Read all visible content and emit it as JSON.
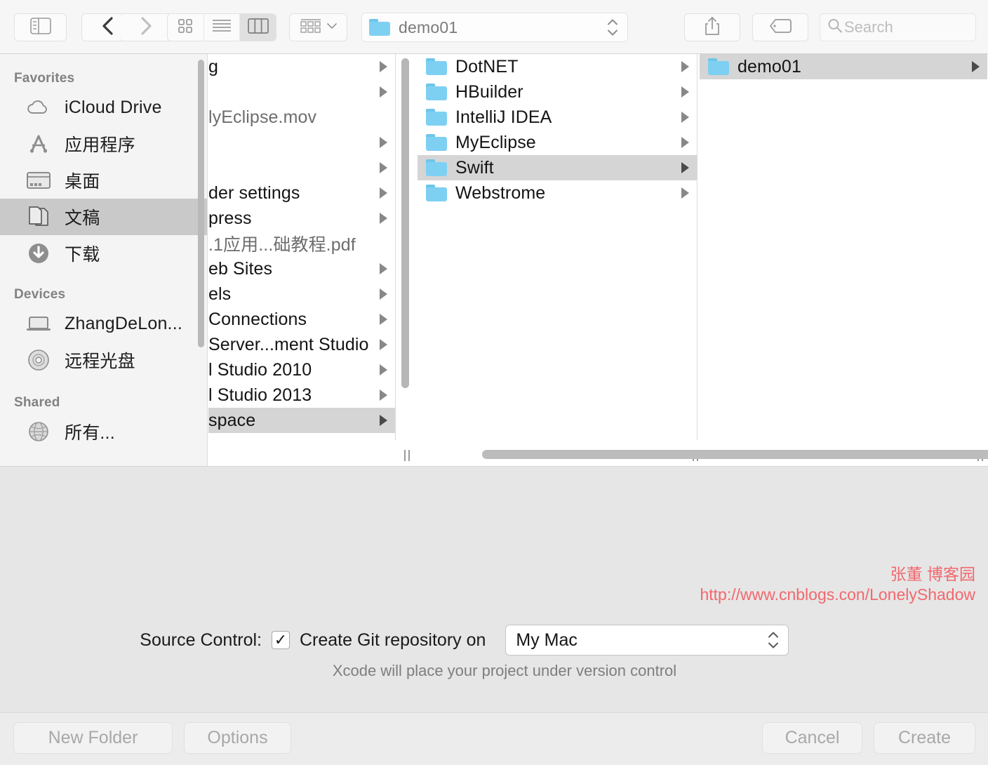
{
  "toolbar": {
    "sidebar_toggle_icon": "sidebar-toggle-icon",
    "back_icon": "chevron-left-icon",
    "forward_icon": "chevron-right-icon",
    "view_icon_grid": "grid-view-icon",
    "view_icon_list": "list-view-icon",
    "view_icon_column": "column-view-icon",
    "active_view": "column",
    "arrange_icon": "arrange-icon",
    "arrange_chevron": "chevron-down-icon",
    "path_value": "demo01",
    "path_folder_icon": "folder-icon",
    "stepper_icon": "stepper-up-down-icon",
    "share_icon": "share-icon",
    "tag_icon": "tag-icon",
    "search_icon": "search-icon",
    "search_placeholder": "Search",
    "search_value": ""
  },
  "sidebar": {
    "groups": [
      {
        "title": "Favorites",
        "items": [
          {
            "label": "iCloud Drive",
            "icon": "icloud-icon",
            "selected": false
          },
          {
            "label": "应用程序",
            "icon": "applications-icon",
            "selected": false
          },
          {
            "label": "桌面",
            "icon": "desktop-icon",
            "selected": false
          },
          {
            "label": "文稿",
            "icon": "documents-icon",
            "selected": true
          },
          {
            "label": "下载",
            "icon": "downloads-icon",
            "selected": false
          }
        ]
      },
      {
        "title": "Devices",
        "items": [
          {
            "label": "ZhangDeLon...",
            "icon": "laptop-icon",
            "selected": false
          },
          {
            "label": "远程光盘",
            "icon": "disc-icon",
            "selected": false
          }
        ]
      },
      {
        "title": "Shared",
        "items": [
          {
            "label": "所有...",
            "icon": "network-globe-icon",
            "selected": false
          }
        ]
      }
    ]
  },
  "columns": [
    {
      "name": "column-1",
      "scrolled_horizontally": true,
      "rows": [
        {
          "label": "g",
          "dim": false,
          "disclosure": true,
          "selected": false
        },
        {
          "label": "",
          "dim": false,
          "disclosure": true,
          "selected": false
        },
        {
          "label": "lyEclipse.mov",
          "dim": true,
          "disclosure": false,
          "selected": false
        },
        {
          "label": "",
          "dim": false,
          "disclosure": true,
          "selected": false
        },
        {
          "label": "",
          "dim": false,
          "disclosure": true,
          "selected": false
        },
        {
          "label": "der settings",
          "dim": false,
          "disclosure": true,
          "selected": false
        },
        {
          "label": "press",
          "dim": false,
          "disclosure": true,
          "selected": false
        },
        {
          "label": ".1应用...础教程.pdf",
          "dim": true,
          "disclosure": false,
          "selected": false
        },
        {
          "label": "eb Sites",
          "dim": false,
          "disclosure": true,
          "selected": false
        },
        {
          "label": "els",
          "dim": false,
          "disclosure": true,
          "selected": false
        },
        {
          "label": "Connections",
          "dim": false,
          "disclosure": true,
          "selected": false
        },
        {
          "label": "Server...ment Studio",
          "dim": false,
          "disclosure": true,
          "selected": false
        },
        {
          "label": "l Studio 2010",
          "dim": false,
          "disclosure": true,
          "selected": false
        },
        {
          "label": "l Studio 2013",
          "dim": false,
          "disclosure": true,
          "selected": false
        },
        {
          "label": "space",
          "dim": false,
          "disclosure": true,
          "selected": true
        }
      ]
    },
    {
      "name": "column-2",
      "scrolled_horizontally": false,
      "rows": [
        {
          "label": "DotNET",
          "icon": "folder-icon",
          "disclosure": true,
          "selected": false
        },
        {
          "label": "HBuilder",
          "icon": "folder-icon",
          "disclosure": true,
          "selected": false
        },
        {
          "label": "IntelliJ IDEA",
          "icon": "folder-icon",
          "disclosure": true,
          "selected": false
        },
        {
          "label": "MyEclipse",
          "icon": "folder-icon",
          "disclosure": true,
          "selected": false
        },
        {
          "label": "Swift",
          "icon": "folder-icon",
          "disclosure": true,
          "selected": true
        },
        {
          "label": "Webstrome",
          "icon": "folder-icon",
          "disclosure": true,
          "selected": false
        }
      ]
    },
    {
      "name": "column-3",
      "scrolled_horizontally": false,
      "rows": [
        {
          "label": "demo01",
          "icon": "folder-icon",
          "disclosure": true,
          "selected": true
        }
      ]
    }
  ],
  "watermark": {
    "line1": "张董 博客园",
    "line2": "http://www.cnblogs.con/LonelyShadow",
    "color": "#f2686e"
  },
  "source_control": {
    "label": "Source Control:",
    "checkbox_checked": true,
    "checkbox_glyph": "✓",
    "checkbox_label": "Create Git repository on",
    "select_value": "My Mac",
    "select_icon": "stepper-up-down-icon",
    "hint": "Xcode will place your project under version control"
  },
  "footer": {
    "new_folder_label": "New Folder",
    "options_label": "Options",
    "cancel_label": "Cancel",
    "create_label": "Create"
  }
}
